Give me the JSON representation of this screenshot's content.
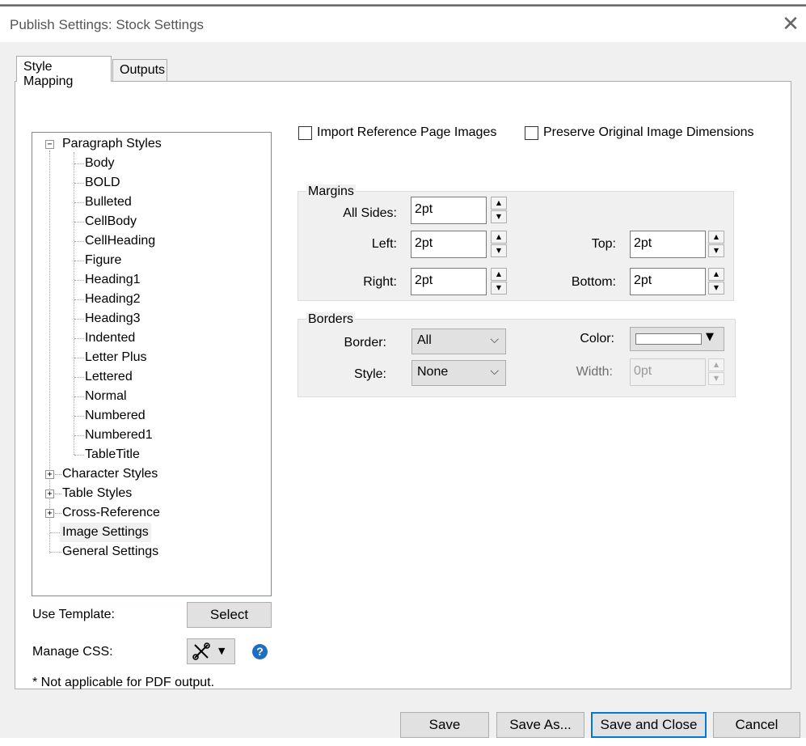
{
  "window": {
    "title": "Publish Settings: Stock Settings",
    "close_glyph": "✕"
  },
  "tabs": [
    {
      "label": "Style Mapping",
      "active": true
    },
    {
      "label": "Outputs",
      "active": false
    }
  ],
  "tree": {
    "paragraph_styles": {
      "label": "Paragraph Styles",
      "expander": "−",
      "children": [
        "Body",
        "BOLD",
        "Bulleted",
        "CellBody",
        "CellHeading",
        "Figure",
        "Heading1",
        "Heading2",
        "Heading3",
        "Indented",
        "Letter Plus",
        "Lettered",
        "Normal",
        "Numbered",
        "Numbered1",
        "TableTitle"
      ]
    },
    "character_styles": {
      "label": "Character Styles",
      "expander": "+"
    },
    "table_styles": {
      "label": "Table Styles",
      "expander": "+"
    },
    "cross_reference": {
      "label": "Cross-Reference",
      "expander": "+"
    },
    "image_settings": {
      "label": "Image Settings",
      "selected": true
    },
    "general_settings": {
      "label": "General Settings"
    }
  },
  "image_options": {
    "import_reference": {
      "label": "Import Reference Page Images",
      "checked": false
    },
    "preserve_dimensions": {
      "label": "Preserve Original Image Dimensions",
      "checked": false
    }
  },
  "margins": {
    "title": "Margins",
    "all_sides": {
      "label": "All Sides:",
      "value": "2pt"
    },
    "left": {
      "label": "Left:",
      "value": "2pt"
    },
    "top": {
      "label": "Top:",
      "value": "2pt"
    },
    "right": {
      "label": "Right:",
      "value": "2pt"
    },
    "bottom": {
      "label": "Bottom:",
      "value": "2pt"
    }
  },
  "borders": {
    "title": "Borders",
    "border": {
      "label": "Border:",
      "value": "All"
    },
    "style": {
      "label": "Style:",
      "value": "None"
    },
    "color": {
      "label": "Color:",
      "value": "#ffffff"
    },
    "width": {
      "label": "Width:",
      "value": "0pt"
    }
  },
  "left_panel": {
    "use_template_label": "Use Template:",
    "select_button": "Select",
    "manage_css_label": "Manage CSS:",
    "manage_css_icon": "tools-icon",
    "help_glyph": "?",
    "note": "* Not applicable for PDF output."
  },
  "glyphs": {
    "up": "▲",
    "down": "▼",
    "chevron": "⌵"
  },
  "footer": {
    "save": "Save",
    "save_as": "Save As...",
    "save_close": "Save and Close",
    "cancel": "Cancel"
  },
  "colors": {
    "accent": "#0078d7",
    "help": "#1e6fc3"
  }
}
